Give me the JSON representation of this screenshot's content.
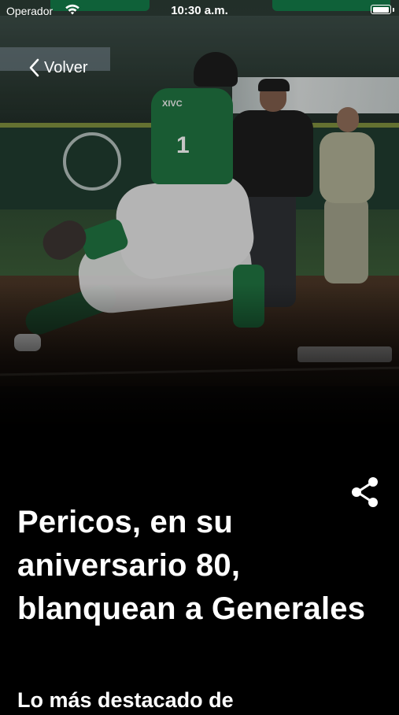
{
  "status_bar": {
    "carrier": "Operador",
    "time": "10:30 a.m.",
    "battery_level": 1.0
  },
  "nav": {
    "back_label": "Volver",
    "back_icon": "chevron-left-icon"
  },
  "hero": {
    "jersey_number": "1",
    "jersey_brand": "XIVC"
  },
  "article": {
    "title": "Pericos, en su aniversario 80, blanquean a Generales",
    "subtitle": "Lo más destacado de"
  },
  "actions": {
    "share_icon": "share-icon"
  },
  "colors": {
    "background": "#000000",
    "text": "#ffffff",
    "team_green": "#1f6f3f"
  }
}
